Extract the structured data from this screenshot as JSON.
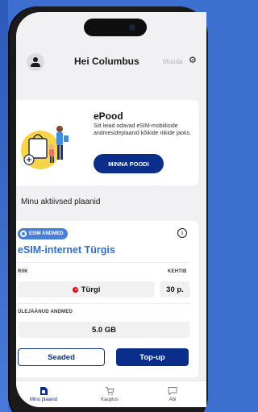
{
  "header": {
    "greeting": "Hei Columbus",
    "edit_label": "Muuda"
  },
  "shop": {
    "title": "ePood",
    "description": "Siit leiad odavad eSIM-mobiiliside andmesideplaanid kõikide riikide jaoks.",
    "button_label": "MINNA POODI"
  },
  "plans_section_title": "Minu aktiivsed plaanid",
  "plan": {
    "badge": "ESIM ANDMED",
    "name": "eSIM-internet Türgis",
    "country_label": "RIIK",
    "validity_label": "KEHTIB",
    "country": "Türgi",
    "validity": "30 p.",
    "remaining_label": "ÜLEJÄÄNUD ANDMED",
    "remaining": "5.0 GB",
    "settings_button": "Seaded",
    "topup_button": "Top-up"
  },
  "tabs": [
    {
      "label": "Minu plaanid",
      "icon": "sim-card-icon",
      "active": true
    },
    {
      "label": "Kauplus",
      "icon": "cart-icon",
      "active": false
    },
    {
      "label": "Abi",
      "icon": "chat-bubble-icon",
      "active": false
    }
  ],
  "colors": {
    "background": "#3d6fd1",
    "primary_dark": "#0b2e8a",
    "accent_blue": "#2e6fd0",
    "badge_blue": "#4a7fd6"
  }
}
